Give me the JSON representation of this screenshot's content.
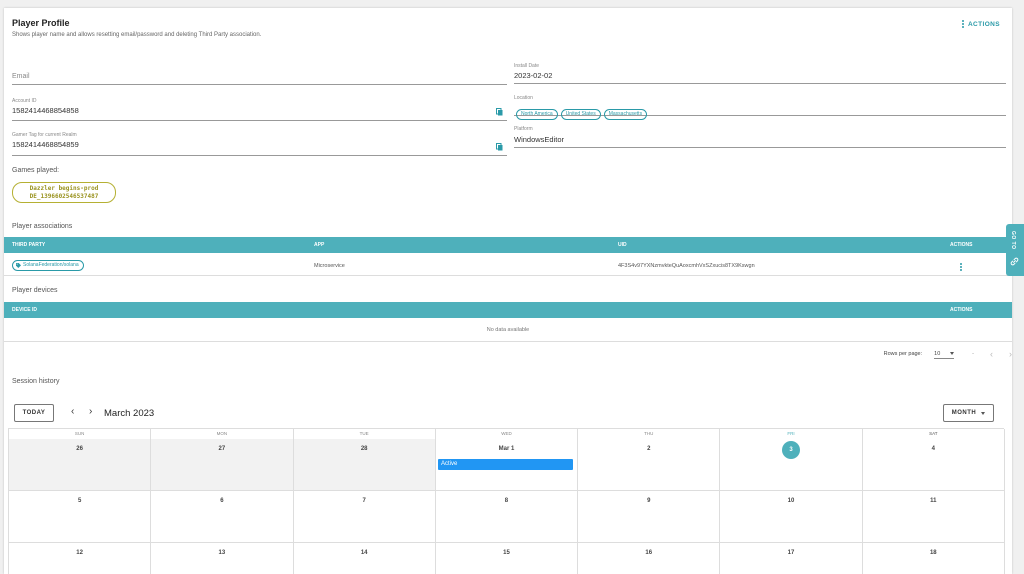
{
  "header": {
    "title": "Player Profile",
    "subtitle": "Shows player name and allows resetting email/password and deleting Third Party association.",
    "actions_label": "ACTIONS"
  },
  "fields": {
    "email": {
      "placeholder": "Email"
    },
    "account_id": {
      "label": "Account ID",
      "value": "1582414468854858"
    },
    "gamer_tag": {
      "label": "Gamer Tag for current Realm",
      "value": "1582414468854859"
    },
    "install_date": {
      "label": "Install Date",
      "value": "2023-02-02"
    },
    "location": {
      "label": "Location",
      "chips": [
        "North America",
        "United States",
        "Massachusetts"
      ]
    },
    "platform": {
      "label": "Platform",
      "value": "WindowsEditor"
    }
  },
  "games": {
    "label": "Games played:",
    "items": [
      {
        "name": "Dazzler begins-prod",
        "id": "DE_1396602546537487"
      }
    ]
  },
  "associations": {
    "label": "Player associations",
    "columns": [
      "THIRD PARTY",
      "APP",
      "UID",
      "ACTIONS"
    ],
    "rows": [
      {
        "third_party": "SolanaFederation/solana",
        "app": "Microservice",
        "uid": "4F3S4v97YXNzmvkteQuAoxcmhVxSZxucis8TX9Kswgn"
      }
    ]
  },
  "devices": {
    "label": "Player devices",
    "columns": [
      "DEVICE ID",
      "ACTIONS"
    ],
    "empty_text": "No data available",
    "pagination": {
      "rows_per_page_label": "Rows per page:",
      "rows_per_page": "10",
      "range": "-"
    }
  },
  "sessions": {
    "label": "Session history",
    "today_label": "TODAY",
    "title": "March 2023",
    "view_label": "MONTH",
    "weekdays": [
      "SUN",
      "MON",
      "TUE",
      "WED",
      "THU",
      "FRI",
      "SAT"
    ],
    "weeks": [
      [
        "26",
        "27",
        "28",
        "Mar 1",
        "2",
        "3",
        "4"
      ],
      [
        "5",
        "6",
        "7",
        "8",
        "9",
        "10",
        "11"
      ],
      [
        "12",
        "13",
        "14",
        "15",
        "16",
        "17",
        "18"
      ]
    ],
    "event_label": "Active"
  },
  "goto": {
    "label": "GO TO"
  },
  "colors": {
    "accent": "#4eb0bb",
    "link": "#2a9aa8",
    "event": "#2196f3",
    "game_chip": "#b5b033"
  }
}
